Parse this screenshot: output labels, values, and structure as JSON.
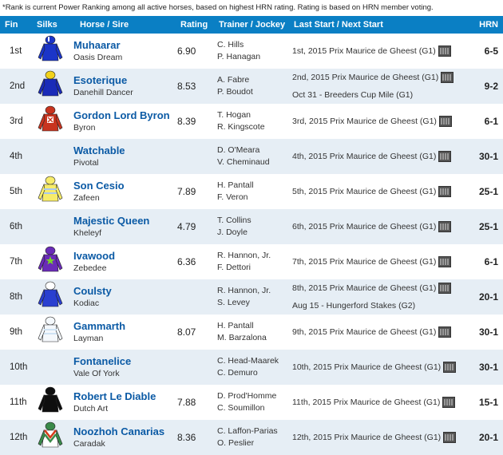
{
  "note": "*Rank is current Power Ranking among all active horses, based on highest HRN rating. Rating is based on HRN member voting.",
  "headers": {
    "fin": "Fin",
    "silks": "Silks",
    "horse": "Horse / Sire",
    "rating": "Rating",
    "trainer_jockey": "Trainer / Jockey",
    "last_next": "Last Start / Next Start",
    "hrn": "HRN"
  },
  "rows": [
    {
      "fin": "1st",
      "horse": "Muhaarar",
      "sire": "Oasis Dream",
      "rating": "6.90",
      "trainer": "C. Hills",
      "jockey": "P. Hanagan",
      "last_start": "1st, 2015 Prix Maurice de Gheest (G1)",
      "next_start": "",
      "odds": "6-5",
      "silk": "blue-white-cap"
    },
    {
      "fin": "2nd",
      "horse": "Esoterique",
      "sire": "Danehill Dancer",
      "rating": "8.53",
      "trainer": "A. Fabre",
      "jockey": "P. Boudot",
      "last_start": "2nd, 2015 Prix Maurice de Gheest (G1)",
      "next_start": "Oct 31 - Breeders Cup Mile (G1)",
      "odds": "9-2",
      "silk": "royal-blue-yellow-cap"
    },
    {
      "fin": "3rd",
      "horse": "Gordon Lord Byron",
      "sire": "Byron",
      "rating": "8.39",
      "trainer": "T. Hogan",
      "jockey": "R. Kingscote",
      "last_start": "3rd, 2015 Prix Maurice de Gheest (G1)",
      "next_start": "",
      "odds": "6-1",
      "silk": "red-white-cross"
    },
    {
      "fin": "4th",
      "horse": "Watchable",
      "sire": "Pivotal",
      "rating": "",
      "trainer": "D. O'Meara",
      "jockey": "V. Cheminaud",
      "last_start": "4th, 2015 Prix Maurice de Gheest (G1)",
      "next_start": "",
      "odds": "30-1",
      "silk": "none"
    },
    {
      "fin": "5th",
      "horse": "Son Cesio",
      "sire": "Zafeen",
      "rating": "7.89",
      "trainer": "H. Pantall",
      "jockey": "F. Veron",
      "last_start": "5th, 2015 Prix Maurice de Gheest (G1)",
      "next_start": "",
      "odds": "25-1",
      "silk": "yellow-blue-hoops"
    },
    {
      "fin": "6th",
      "horse": "Majestic Queen",
      "sire": "Kheleyf",
      "rating": "4.79",
      "trainer": "T. Collins",
      "jockey": "J. Doyle",
      "last_start": "6th, 2015 Prix Maurice de Gheest (G1)",
      "next_start": "",
      "odds": "25-1",
      "silk": "none"
    },
    {
      "fin": "7th",
      "horse": "Ivawood",
      "sire": "Zebedee",
      "rating": "6.36",
      "trainer": "R. Hannon, Jr.",
      "jockey": "F. Dettori",
      "last_start": "7th, 2015 Prix Maurice de Gheest (G1)",
      "next_start": "",
      "odds": "6-1",
      "silk": "purple-green-star"
    },
    {
      "fin": "8th",
      "horse": "Coulsty",
      "sire": "Kodiac",
      "rating": "",
      "trainer": "R. Hannon, Jr.",
      "jockey": "S. Levey",
      "last_start": "8th, 2015 Prix Maurice de Gheest (G1)",
      "next_start": "Aug 15 - Hungerford Stakes (G2)",
      "odds": "20-1",
      "silk": "blue-white"
    },
    {
      "fin": "9th",
      "horse": "Gammarth",
      "sire": "Layman",
      "rating": "8.07",
      "trainer": "H. Pantall",
      "jockey": "M. Barzalona",
      "last_start": "9th, 2015 Prix Maurice de Gheest (G1)",
      "next_start": "",
      "odds": "30-1",
      "silk": "white-lightblue"
    },
    {
      "fin": "10th",
      "horse": "Fontanelice",
      "sire": "Vale Of York",
      "rating": "",
      "trainer": "C. Head-Maarek",
      "jockey": "C. Demuro",
      "last_start": "10th, 2015 Prix Maurice de Gheest (G1)",
      "next_start": "",
      "odds": "30-1",
      "silk": "none"
    },
    {
      "fin": "11th",
      "horse": "Robert Le Diable",
      "sire": "Dutch Art",
      "rating": "7.88",
      "trainer": "D. Prod'Homme",
      "jockey": "C. Soumillon",
      "last_start": "11th, 2015 Prix Maurice de Gheest (G1)",
      "next_start": "",
      "odds": "15-1",
      "silk": "black"
    },
    {
      "fin": "12th",
      "horse": "Noozhoh Canarias",
      "sire": "Caradak",
      "rating": "8.36",
      "trainer": "C. Laffon-Parias",
      "jockey": "O. Peslier",
      "last_start": "12th, 2015 Prix Maurice de Gheest (G1)",
      "next_start": "",
      "odds": "20-1",
      "silk": "green-red-chevrons"
    }
  ],
  "colors": {
    "header_bg": "#0a7fc4",
    "row_alt": "#e6eef5",
    "horse_link": "#0b5aa5"
  },
  "icons": {
    "video": "video-replay-icon",
    "silk": "jockey-silks-icon"
  }
}
